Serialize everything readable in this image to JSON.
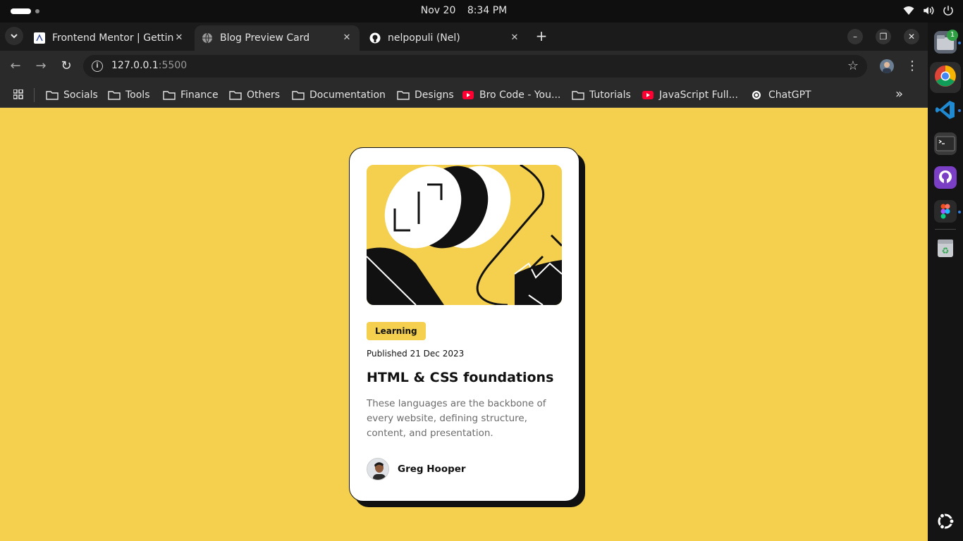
{
  "system": {
    "date": "Nov 20",
    "time": "8:34 PM",
    "icons": [
      "wifi-icon",
      "volume-icon",
      "power-icon"
    ]
  },
  "browser": {
    "tabs": [
      {
        "title": "Frontend Mentor | Gettin",
        "favicon": "frontend-mentor-icon",
        "active": false
      },
      {
        "title": "Blog Preview Card",
        "favicon": "globe-icon",
        "active": true
      },
      {
        "title": "nelpopuli (Nel)",
        "favicon": "github-icon",
        "active": false
      }
    ],
    "url": {
      "host": "127.0.0.1",
      "port": ":5500"
    },
    "bookmarks": [
      {
        "label": "Socials",
        "icon": "folder-icon"
      },
      {
        "label": "Tools",
        "icon": "folder-icon"
      },
      {
        "label": "Finance",
        "icon": "folder-icon"
      },
      {
        "label": "Others",
        "icon": "folder-icon"
      },
      {
        "label": "Documentation",
        "icon": "folder-icon"
      },
      {
        "label": "Designs",
        "icon": "folder-icon"
      },
      {
        "label": "Bro Code - You...",
        "icon": "youtube-icon"
      },
      {
        "label": "Tutorials",
        "icon": "folder-icon"
      },
      {
        "label": "JavaScript Full...",
        "icon": "youtube-icon"
      },
      {
        "label": "ChatGPT",
        "icon": "chatgpt-icon"
      }
    ]
  },
  "card": {
    "badge": "Learning",
    "published": "Published 21 Dec 2023",
    "title": "HTML & CSS foundations",
    "description": "These languages are the backbone of every website, defining structure, content, and presentation.",
    "author": "Greg Hooper"
  },
  "dock": {
    "files_badge": "1",
    "items": [
      "files-icon",
      "chrome-icon",
      "vscode-icon",
      "terminal-icon",
      "github-desktop-icon",
      "figma-icon",
      "trash-icon",
      "ubuntu-apps-icon"
    ]
  },
  "colors": {
    "page_bg": "#f4d04e",
    "card_bg": "#ffffff",
    "text": "#111111"
  }
}
